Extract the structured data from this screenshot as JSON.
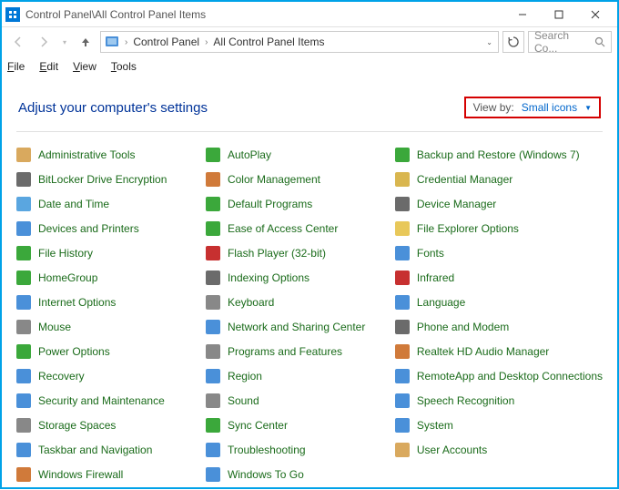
{
  "window": {
    "title": "Control Panel\\All Control Panel Items"
  },
  "address": {
    "crumb1": "Control Panel",
    "crumb2": "All Control Panel Items"
  },
  "search": {
    "placeholder": "Search Co..."
  },
  "menu": {
    "file": "File",
    "edit": "Edit",
    "view": "View",
    "tools": "Tools"
  },
  "heading": "Adjust your computer's settings",
  "viewby": {
    "label": "View by:",
    "value": "Small icons"
  },
  "items": {
    "r0c0": "Administrative Tools",
    "r0c1": "AutoPlay",
    "r0c2": "Backup and Restore (Windows 7)",
    "r1c0": "BitLocker Drive Encryption",
    "r1c1": "Color Management",
    "r1c2": "Credential Manager",
    "r2c0": "Date and Time",
    "r2c1": "Default Programs",
    "r2c2": "Device Manager",
    "r3c0": "Devices and Printers",
    "r3c1": "Ease of Access Center",
    "r3c2": "File Explorer Options",
    "r4c0": "File History",
    "r4c1": "Flash Player (32-bit)",
    "r4c2": "Fonts",
    "r5c0": "HomeGroup",
    "r5c1": "Indexing Options",
    "r5c2": "Infrared",
    "r6c0": "Internet Options",
    "r6c1": "Keyboard",
    "r6c2": "Language",
    "r7c0": "Mouse",
    "r7c1": "Network and Sharing Center",
    "r7c2": "Phone and Modem",
    "r8c0": "Power Options",
    "r8c1": "Programs and Features",
    "r8c2": "Realtek HD Audio Manager",
    "r9c0": "Recovery",
    "r9c1": "Region",
    "r9c2": "RemoteApp and Desktop Connections",
    "r10c0": "Security and Maintenance",
    "r10c1": "Sound",
    "r10c2": "Speech Recognition",
    "r11c0": "Storage Spaces",
    "r11c1": "Sync Center",
    "r11c2": "System",
    "r12c0": "Taskbar and Navigation",
    "r12c1": "Troubleshooting",
    "r12c2": "User Accounts",
    "r13c0": "Windows Firewall",
    "r13c1": "Windows To Go"
  },
  "icon_colors": {
    "r0c0": "#d9a95e",
    "r0c1": "#3ba83b",
    "r0c2": "#3ba83b",
    "r1c0": "#6b6b6b",
    "r1c1": "#d07a3a",
    "r1c2": "#d9b64f",
    "r2c0": "#5aa6e0",
    "r2c1": "#3ba83b",
    "r2c2": "#6b6b6b",
    "r3c0": "#4a90d9",
    "r3c1": "#3ba83b",
    "r3c2": "#e8c85a",
    "r4c0": "#3ba83b",
    "r4c1": "#c73030",
    "r4c2": "#4a90d9",
    "r5c0": "#3ba83b",
    "r5c1": "#6b6b6b",
    "r5c2": "#c73030",
    "r6c0": "#4a90d9",
    "r6c1": "#888",
    "r6c2": "#4a90d9",
    "r7c0": "#888",
    "r7c1": "#4a90d9",
    "r7c2": "#6b6b6b",
    "r8c0": "#3ba83b",
    "r8c1": "#888",
    "r8c2": "#d07a3a",
    "r9c0": "#4a90d9",
    "r9c1": "#4a90d9",
    "r9c2": "#4a90d9",
    "r10c0": "#4a90d9",
    "r10c1": "#888",
    "r10c2": "#4a90d9",
    "r11c0": "#888",
    "r11c1": "#3ba83b",
    "r11c2": "#4a90d9",
    "r12c0": "#4a90d9",
    "r12c1": "#4a90d9",
    "r12c2": "#d9a95e",
    "r13c0": "#d07a3a",
    "r13c1": "#4a90d9"
  }
}
